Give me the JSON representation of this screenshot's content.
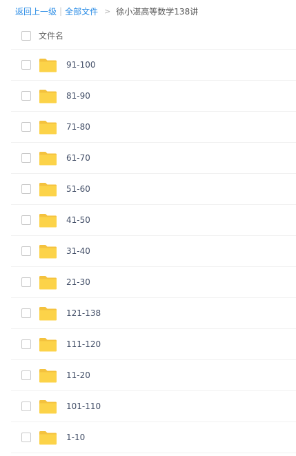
{
  "breadcrumb": {
    "back": "返回上一级",
    "separator": "|",
    "all_files": "全部文件",
    "arrow": ">",
    "current": "徐小湛高等数学138讲"
  },
  "table": {
    "header_label": "文件名",
    "folder_icon": "folder-icon",
    "folder_color": "#fcd349",
    "rows": [
      {
        "name": "91-100"
      },
      {
        "name": "81-90"
      },
      {
        "name": "71-80"
      },
      {
        "name": "61-70"
      },
      {
        "name": "51-60"
      },
      {
        "name": "41-50"
      },
      {
        "name": "31-40"
      },
      {
        "name": "21-30"
      },
      {
        "name": "121-138"
      },
      {
        "name": "111-120"
      },
      {
        "name": "11-20"
      },
      {
        "name": "101-110"
      },
      {
        "name": "1-10"
      }
    ]
  },
  "colors": {
    "link": "#2a8ce6",
    "row_border": "#f1f1f1",
    "file_name": "#424e67"
  }
}
